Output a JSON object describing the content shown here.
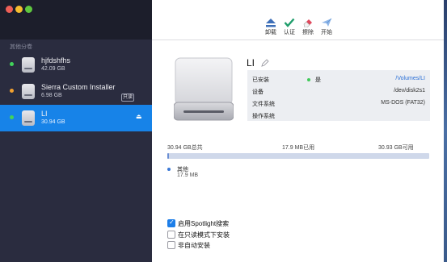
{
  "window": {
    "accent_color": "#1783e8"
  },
  "sidebar": {
    "section_title": "其他分卷",
    "items": [
      {
        "name": "hjfdshfhs",
        "size": "42.09 GB",
        "status_color": "#41d35a"
      },
      {
        "name": "Sierra Custom Installer",
        "size": "6.98 GB",
        "badge": "只读",
        "status_color": "#f3a12f"
      },
      {
        "name": "LI",
        "size": "30.94 GB",
        "status_color": "#41d35a",
        "selected": true
      }
    ]
  },
  "toolbar": {
    "buttons": [
      {
        "label": "卸载",
        "icon": "eject-icon"
      },
      {
        "label": "认证",
        "icon": "checkmark-icon"
      },
      {
        "label": "擦除",
        "icon": "eraser-icon"
      },
      {
        "label": "开始",
        "icon": "paper-plane-icon"
      }
    ]
  },
  "volume": {
    "name": "LI",
    "info": {
      "mounted_label": "已安装",
      "mounted_value": "是",
      "mount_path": "/Volumes/LI",
      "device_label": "设备",
      "device_value": "/dev/disk2s1",
      "fs_label": "文件系统",
      "fs_value": "MS-DOS (FAT32)",
      "os_label": "操作系统",
      "os_value": ""
    }
  },
  "capacity": {
    "total": "30.94 GB总共",
    "used": "17.9 MB已用",
    "available": "30.93 GB可用",
    "used_fraction": 0.0006,
    "legend_name": "其他",
    "legend_size": "17.9 MB"
  },
  "options": [
    {
      "label": "启用Spotlight搜索",
      "checked": true
    },
    {
      "label": "在只读模式下安装",
      "checked": false
    },
    {
      "label": "非自动安装",
      "checked": false
    }
  ]
}
